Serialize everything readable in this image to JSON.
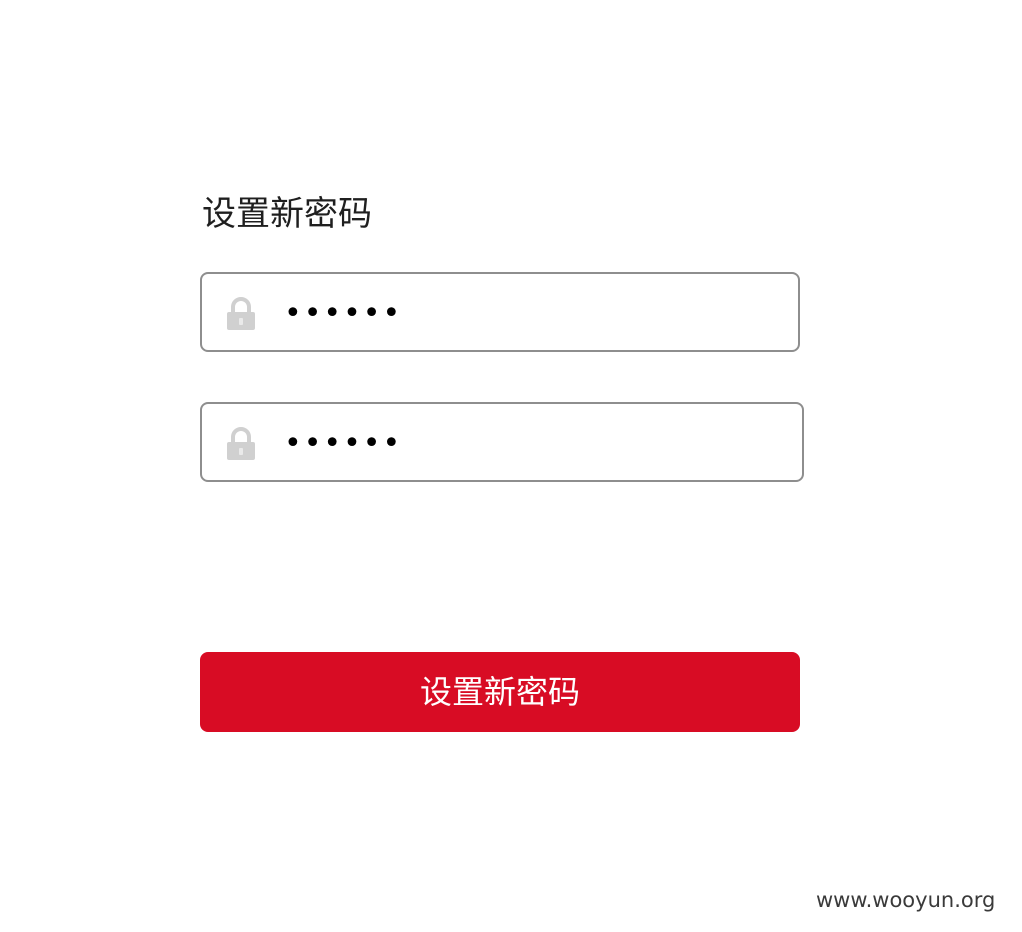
{
  "form": {
    "title": "设置新密码",
    "fields": [
      {
        "value": "123456",
        "icon": "lock-icon"
      },
      {
        "value": "123456",
        "icon": "lock-icon"
      }
    ],
    "submit_label": "设置新密码"
  },
  "watermark": "www.wooyun.org",
  "colors": {
    "primary_button": "#d80c24",
    "field_border": "#8e8e8e",
    "icon": "#d0d0d0"
  }
}
